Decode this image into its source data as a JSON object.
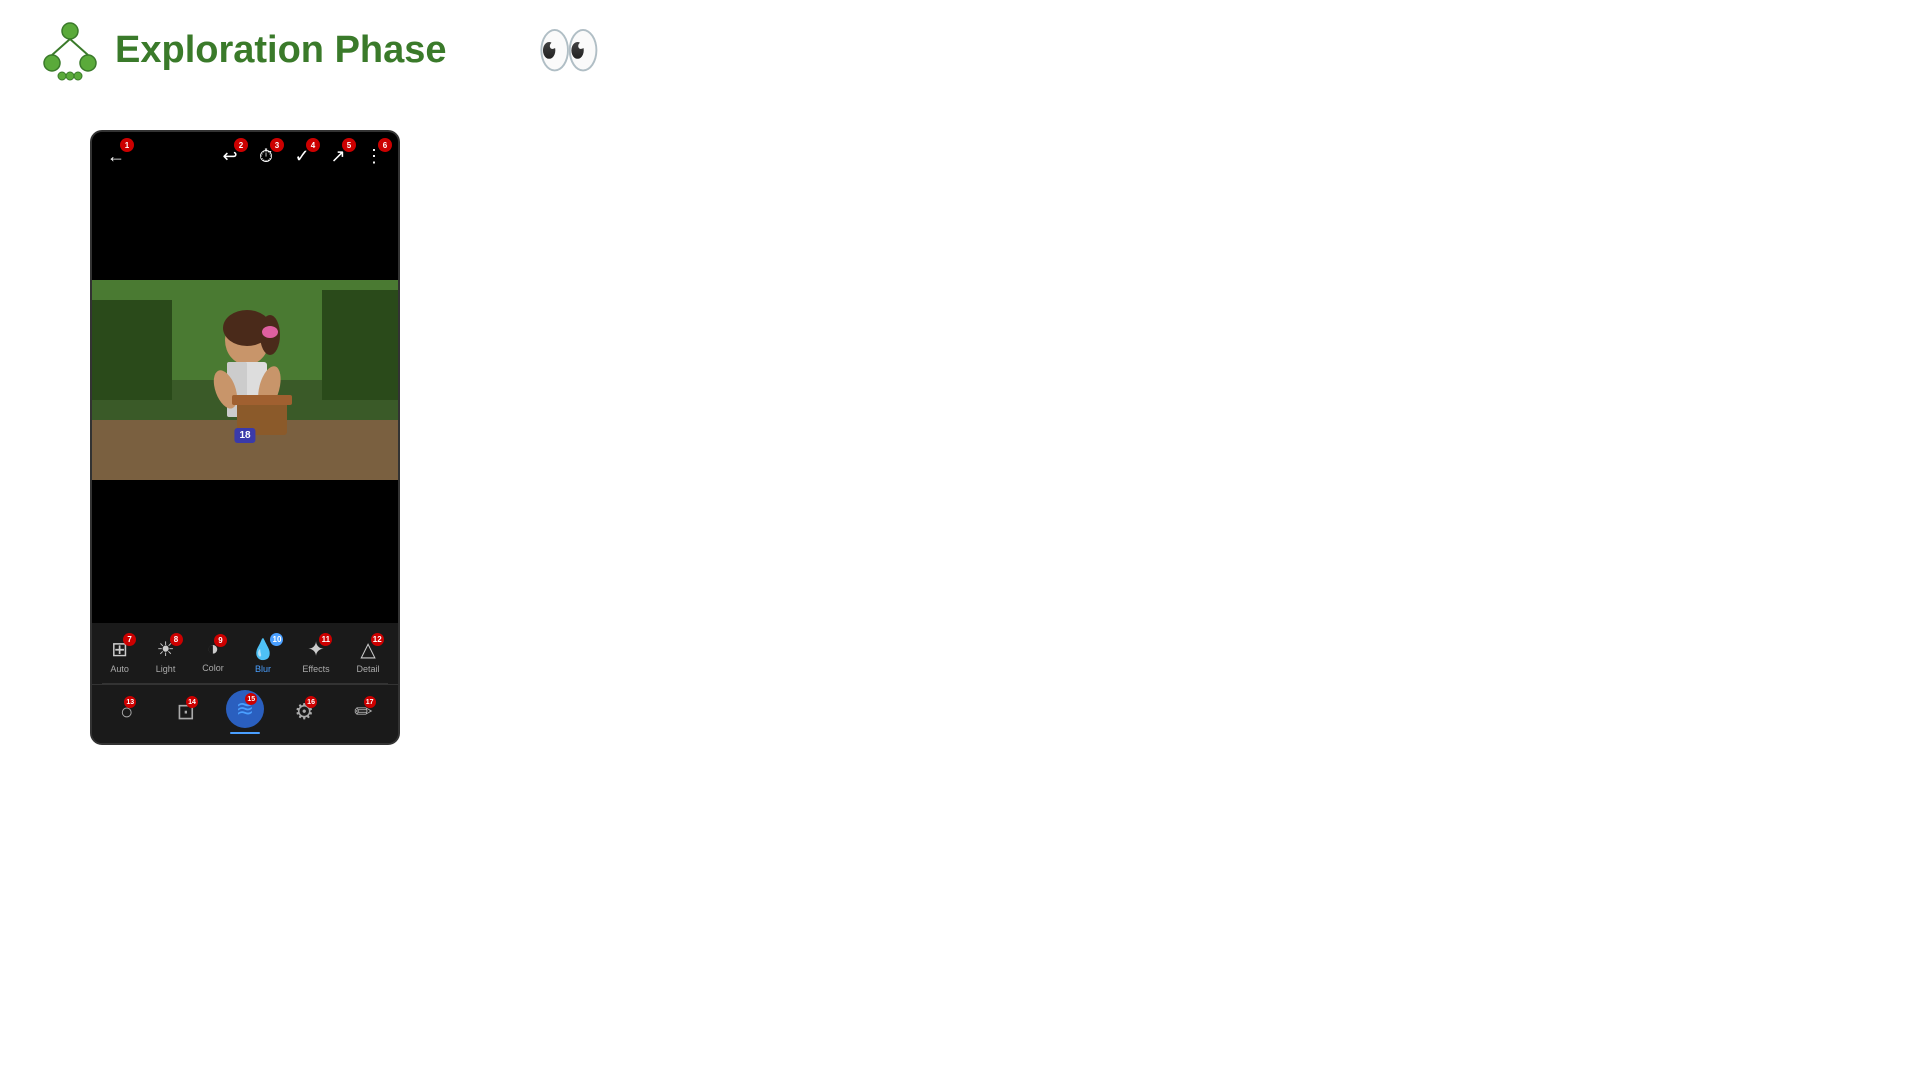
{
  "header": {
    "title": "Exploration Phase",
    "logo_alt": "tree-logo"
  },
  "phone": {
    "top_bar": {
      "buttons": [
        {
          "icon": "←",
          "badge": "1",
          "name": "back"
        },
        {
          "icon": "↩",
          "badge": "2",
          "name": "undo"
        },
        {
          "icon": "⏱",
          "badge": "3",
          "name": "history"
        },
        {
          "icon": "✓",
          "badge": "4",
          "name": "apply"
        },
        {
          "icon": "↗",
          "badge": "5",
          "name": "share"
        },
        {
          "icon": "⋮",
          "badge": "6",
          "name": "more"
        }
      ]
    },
    "photo_label": "18",
    "toolbar": {
      "items": [
        {
          "icon": "⊞",
          "label": "Auto",
          "badge": "7",
          "badge_color": "red"
        },
        {
          "icon": "☀",
          "label": "Light",
          "badge": "8",
          "badge_color": "red"
        },
        {
          "icon": "◑",
          "label": "Color",
          "badge": "9",
          "badge_color": "red"
        },
        {
          "icon": "💧",
          "label": "Blur",
          "badge": "10",
          "badge_color": "blue",
          "active": true
        },
        {
          "icon": "✦",
          "label": "Effects",
          "badge": "11",
          "badge_color": "red"
        },
        {
          "icon": "△",
          "label": "Detail",
          "badge": "12",
          "badge_color": "red"
        }
      ],
      "sub_items": [
        {
          "icon": "○",
          "badge": "13",
          "active": false
        },
        {
          "icon": "⊡",
          "badge": "14",
          "active": false
        },
        {
          "icon": "≋",
          "badge": "15",
          "active": true
        },
        {
          "icon": "⚙",
          "badge": "16",
          "active": false
        },
        {
          "icon": "✏",
          "badge": "17",
          "active": false
        }
      ]
    }
  }
}
